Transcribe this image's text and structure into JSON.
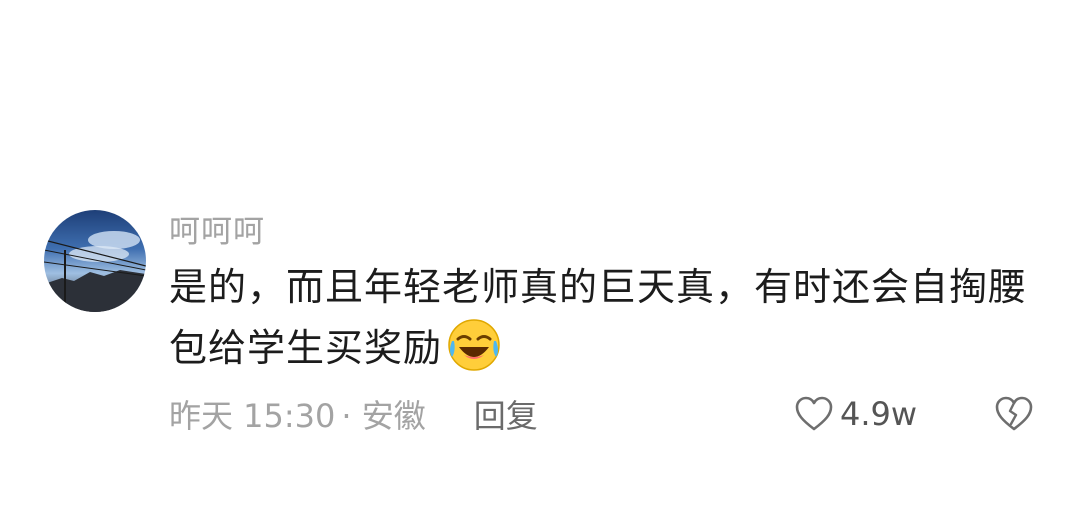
{
  "comment": {
    "username": "呵呵呵",
    "text": "是的，而且年轻老师真的巨天真，有时还会自掏腰包给学生买奖励",
    "emoji": "laughing-crying-emoji",
    "timestamp": "昨天 15:30",
    "location": "· 安徽",
    "reply_label": "回复",
    "like_count": "4.9w"
  },
  "icons": {
    "like": "heart-outline-icon",
    "dislike": "broken-heart-icon"
  },
  "colors": {
    "meta_text": "#a3a3a3",
    "body_text": "#1c1c1c",
    "icon_stroke": "#6e6e6e"
  }
}
